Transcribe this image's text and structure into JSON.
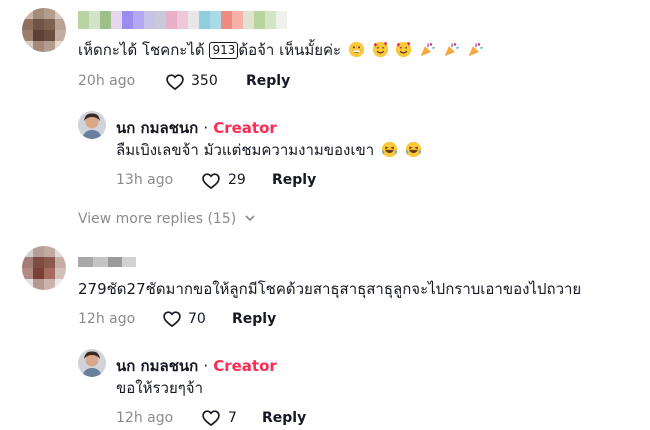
{
  "comment1": {
    "text_before": "เห็ดกะได้ โชคกะได้",
    "tag": "913",
    "text_after": "ด้อจ้า เห็นมั้ยค่ะ",
    "emojis": [
      "grinning-face-icon",
      "smiling-hearts-face-icon",
      "smiling-hearts-face-icon",
      "party-popper-icon",
      "party-popper-icon",
      "party-popper-icon"
    ],
    "time": "20h ago",
    "likes": "350",
    "reply_label": "Reply"
  },
  "reply1": {
    "author": "นก กมลชนก",
    "separator": "·",
    "badge": "Creator",
    "text": "ลืมเบิงเลขจ้า มัวแต่ชมความงามของเขา",
    "emojis": [
      "laughing-face-icon",
      "laughing-face-icon"
    ],
    "time": "13h ago",
    "likes": "29",
    "reply_label": "Reply"
  },
  "view_more": "View more replies (15)",
  "comment2": {
    "text": "279ชัด27ชัดมากขอให้ลูกมีโชคด้วยสาธุสาธุสาธุลูกจะไปกราบเอาของไปถวาย",
    "time": "12h ago",
    "likes": "70",
    "reply_label": "Reply"
  },
  "reply2": {
    "author": "นก กมลชนก",
    "separator": "·",
    "badge": "Creator",
    "text": "ขอให้รวยๆจ้า",
    "time": "12h ago",
    "likes": "7",
    "reply_label": "Reply"
  },
  "colors": {
    "creator": "#fe2c55",
    "muted": "#8a8b91",
    "text": "#161823"
  }
}
